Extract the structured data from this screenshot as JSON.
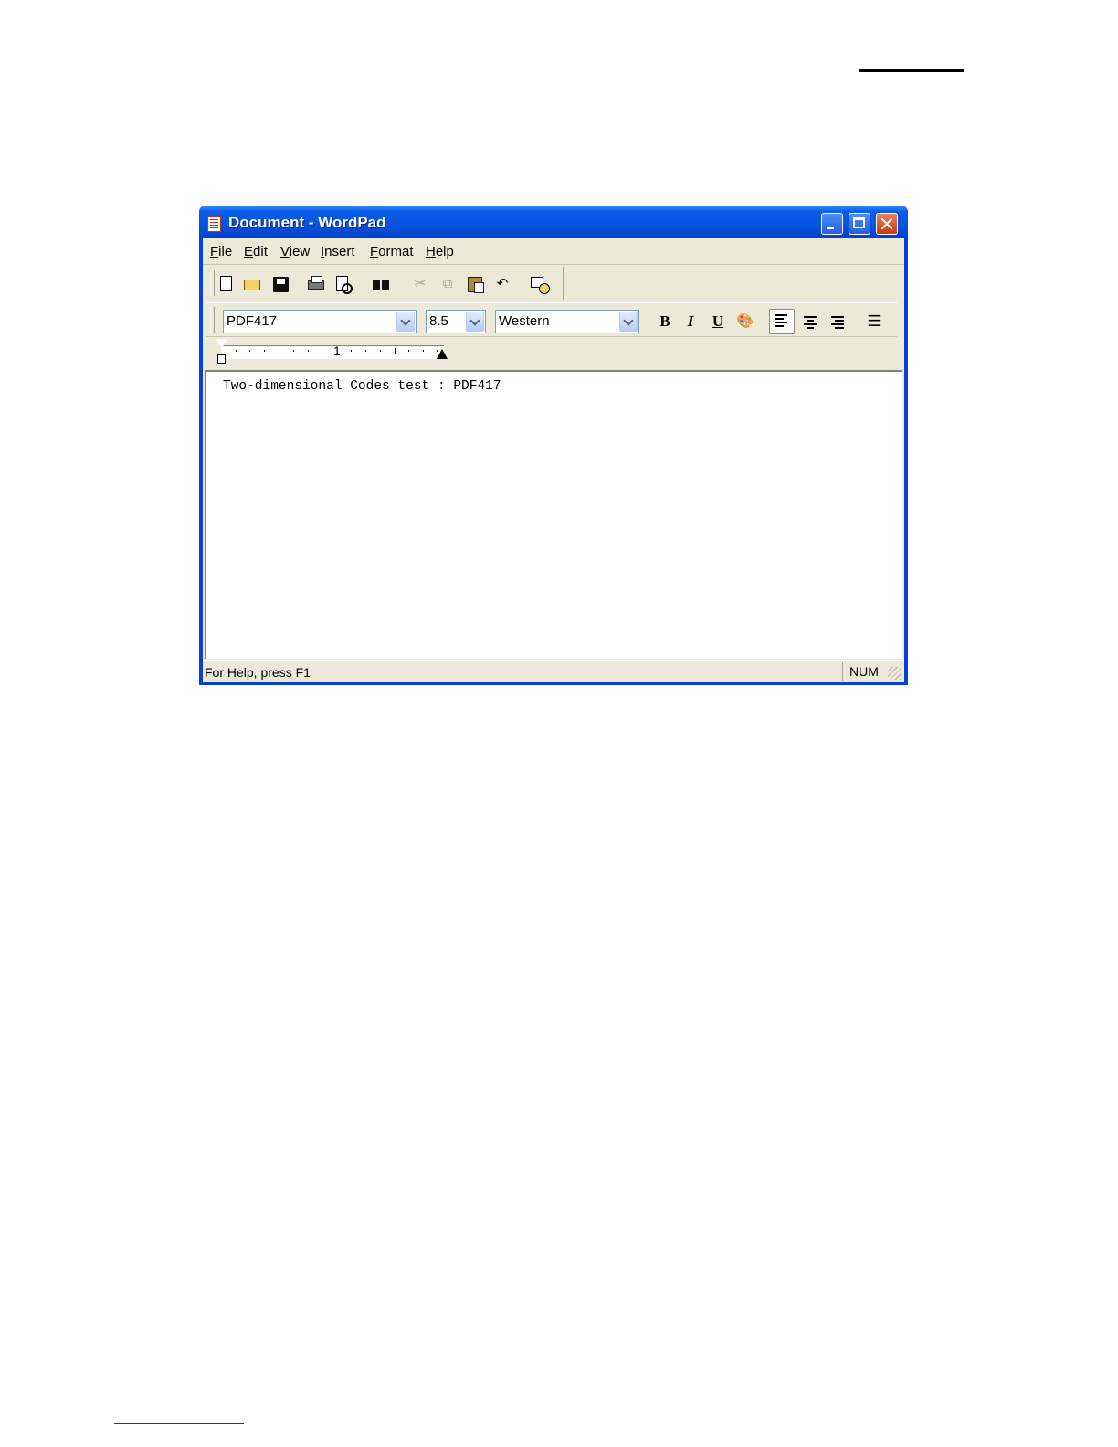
{
  "window": {
    "title": "Document - WordPad"
  },
  "menu": [
    "File",
    "Edit",
    "View",
    "Insert",
    "Format",
    "Help"
  ],
  "toolbar": {
    "icons": [
      "new-icon",
      "open-icon",
      "save-icon",
      "print-icon",
      "print-preview-icon",
      "find-icon",
      "cut-icon",
      "copy-icon",
      "paste-icon",
      "undo-icon",
      "date-time-icon"
    ],
    "undo_glyph": "↶",
    "cut_glyph": "✂",
    "copy_glyph": "⧉"
  },
  "format_bar": {
    "font": "PDF417",
    "size": "8.5",
    "script": "Western",
    "bold": "B",
    "italic": "I",
    "underline": "U",
    "color_glyph": "🎨",
    "bullet_glyph": "☰"
  },
  "ruler": {
    "label": "1"
  },
  "document": {
    "text": "Two-dimensional Codes test : PDF417"
  },
  "status": {
    "help": "For Help, press F1",
    "num": "NUM"
  },
  "colors": {
    "title_bar": "#0653df",
    "chrome": "#ece9d8",
    "close_button": "#c63a17"
  }
}
